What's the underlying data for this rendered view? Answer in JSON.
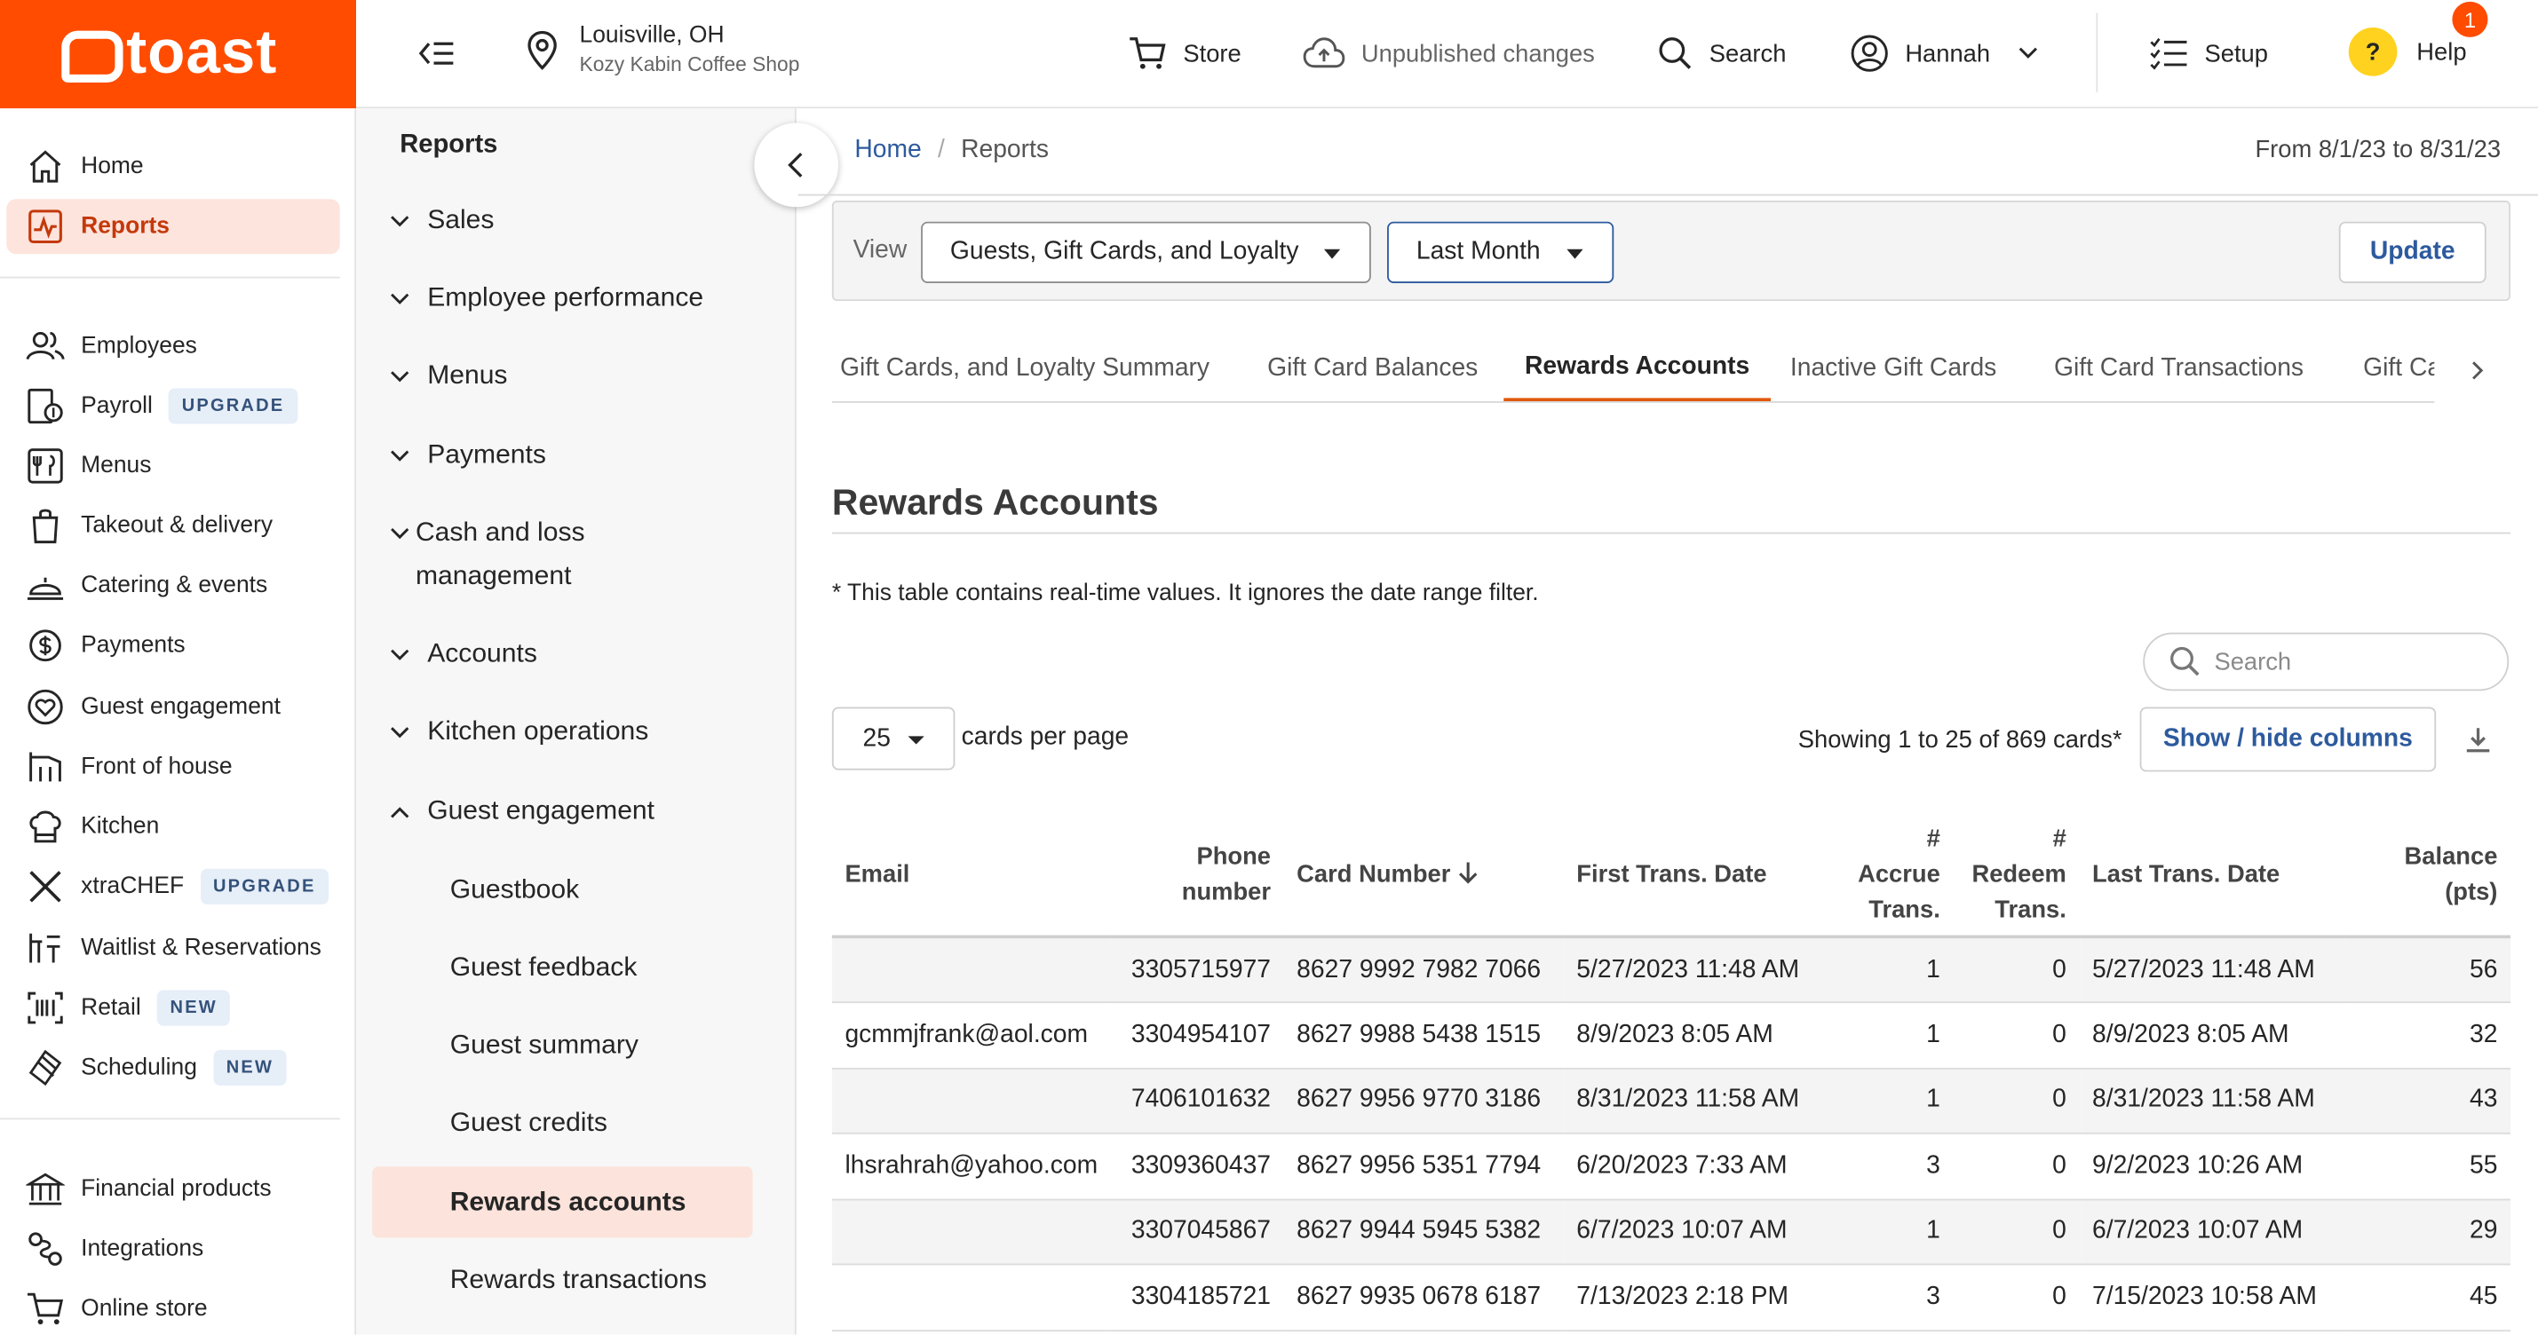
{
  "brand": {
    "name": "toast",
    "color": "#ff4c00"
  },
  "topbar": {
    "location_city": "Louisville, OH",
    "location_shop": "Kozy Kabin Coffee Shop",
    "store": "Store",
    "unpublished": "Unpublished changes",
    "search": "Search",
    "user": "Hannah",
    "setup": "Setup",
    "help": "Help",
    "help_badge": "1",
    "help_icon_text": "?"
  },
  "sidebar": {
    "items": [
      {
        "label": "Home",
        "icon": "home-icon"
      },
      {
        "label": "Reports",
        "icon": "reports-icon",
        "active": true
      },
      {
        "label": "Employees",
        "icon": "employees-icon"
      },
      {
        "label": "Payroll",
        "icon": "payroll-icon",
        "pill": "UPGRADE"
      },
      {
        "label": "Menus",
        "icon": "menus-icon"
      },
      {
        "label": "Takeout & delivery",
        "icon": "takeout-icon"
      },
      {
        "label": "Catering & events",
        "icon": "catering-icon"
      },
      {
        "label": "Payments",
        "icon": "payments-icon"
      },
      {
        "label": "Guest engagement",
        "icon": "guest-engagement-icon"
      },
      {
        "label": "Front of house",
        "icon": "front-of-house-icon"
      },
      {
        "label": "Kitchen",
        "icon": "kitchen-icon"
      },
      {
        "label": "xtraCHEF",
        "icon": "xtrachef-icon",
        "pill": "UPGRADE"
      },
      {
        "label": "Waitlist & Reservations",
        "icon": "waitlist-icon"
      },
      {
        "label": "Retail",
        "icon": "retail-icon",
        "pill": "NEW"
      },
      {
        "label": "Scheduling",
        "icon": "scheduling-icon",
        "pill": "NEW"
      },
      {
        "label": "Financial products",
        "icon": "financial-icon"
      },
      {
        "label": "Integrations",
        "icon": "integrations-icon"
      },
      {
        "label": "Online store",
        "icon": "online-store-icon"
      }
    ]
  },
  "subnav": {
    "title": "Reports",
    "groups": [
      "Sales",
      "Employee performance",
      "Menus",
      "Payments",
      "Cash and loss management",
      "Accounts",
      "Kitchen operations",
      "Guest engagement"
    ],
    "guest_items": [
      "Guestbook",
      "Guest feedback",
      "Guest summary",
      "Guest credits",
      "Rewards accounts",
      "Rewards transactions"
    ],
    "active_item": "Rewards accounts"
  },
  "main": {
    "breadcrumb_home": "Home",
    "breadcrumb_current": "Reports",
    "date_range": "From 8/1/23 to 8/31/23",
    "view_label": "View",
    "view_value": "Guests, Gift Cards, and Loyalty",
    "period_value": "Last Month",
    "update": "Update",
    "tabs": [
      "Gift Cards, and Loyalty Summary",
      "Gift Card Balances",
      "Rewards Accounts",
      "Inactive Gift Cards",
      "Gift Card Transactions",
      "Gift Ca"
    ],
    "active_tab": "Rewards Accounts",
    "section_title": "Rewards Accounts",
    "note": "* This table contains real-time values. It ignores the date range filter.",
    "search_placeholder": "Search",
    "per_page": "25",
    "per_page_label": "cards per page",
    "showing": "Showing 1 to 25 of 869 cards*",
    "show_hide": "Show / hide columns"
  },
  "table": {
    "headers": {
      "email": "Email",
      "phone_1": "Phone",
      "phone_2": "number",
      "card": "Card Number",
      "first": "First Trans. Date",
      "accrue_1": "#",
      "accrue_2": "Accrue",
      "accrue_3": "Trans.",
      "redeem_1": "#",
      "redeem_2": "Redeem",
      "redeem_3": "Trans.",
      "last": "Last Trans. Date",
      "balance_1": "Balance",
      "balance_2": "(pts)"
    },
    "rows": [
      {
        "email": "",
        "phone": "3305715977",
        "card": "8627 9992 7982 7066",
        "first": "5/27/2023 11:48 AM",
        "accrue": "1",
        "redeem": "0",
        "last": "5/27/2023 11:48 AM",
        "balance": "56"
      },
      {
        "email": "gcmmjfrank@aol.com",
        "phone": "3304954107",
        "card": "8627 9988 5438 1515",
        "first": "8/9/2023 8:05 AM",
        "accrue": "1",
        "redeem": "0",
        "last": "8/9/2023 8:05 AM",
        "balance": "32"
      },
      {
        "email": "",
        "phone": "7406101632",
        "card": "8627 9956 9770 3186",
        "first": "8/31/2023 11:58 AM",
        "accrue": "1",
        "redeem": "0",
        "last": "8/31/2023 11:58 AM",
        "balance": "43"
      },
      {
        "email": "lhsrahrah@yahoo.com",
        "phone": "3309360437",
        "card": "8627 9956 5351 7794",
        "first": "6/20/2023 7:33 AM",
        "accrue": "3",
        "redeem": "0",
        "last": "9/2/2023 10:26 AM",
        "balance": "55"
      },
      {
        "email": "",
        "phone": "3307045867",
        "card": "8627 9944 5945 5382",
        "first": "6/7/2023 10:07 AM",
        "accrue": "1",
        "redeem": "0",
        "last": "6/7/2023 10:07 AM",
        "balance": "29"
      },
      {
        "email": "",
        "phone": "3304185721",
        "card": "8627 9935 0678 6187",
        "first": "7/13/2023 2:18 PM",
        "accrue": "3",
        "redeem": "0",
        "last": "7/15/2023 10:58 AM",
        "balance": "45"
      }
    ]
  }
}
